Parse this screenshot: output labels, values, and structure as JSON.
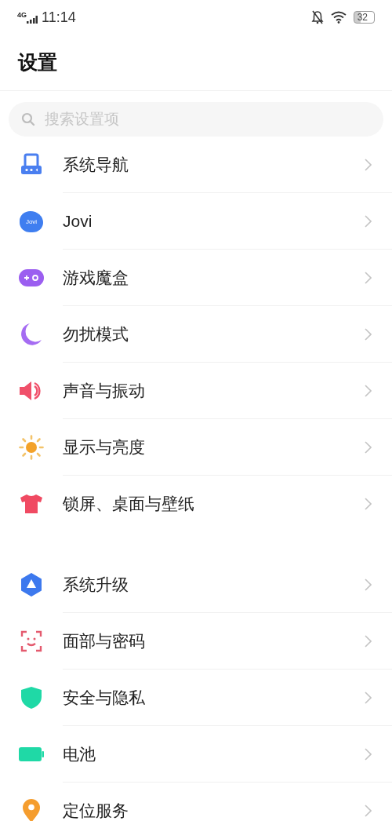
{
  "status_bar": {
    "network": "4G",
    "time": "11:14",
    "battery": "32"
  },
  "header": {
    "title": "设置"
  },
  "search": {
    "placeholder": "搜索设置项"
  },
  "sections": [
    {
      "items": [
        {
          "label": "系统导航"
        },
        {
          "label": "Jovi",
          "icon_text": "Jovi"
        },
        {
          "label": "游戏魔盒"
        },
        {
          "label": "勿扰模式"
        },
        {
          "label": "声音与振动"
        },
        {
          "label": "显示与亮度"
        },
        {
          "label": "锁屏、桌面与壁纸"
        }
      ]
    },
    {
      "items": [
        {
          "label": "系统升级"
        },
        {
          "label": "面部与密码"
        },
        {
          "label": "安全与隐私"
        },
        {
          "label": "电池"
        },
        {
          "label": "定位服务"
        }
      ]
    }
  ]
}
